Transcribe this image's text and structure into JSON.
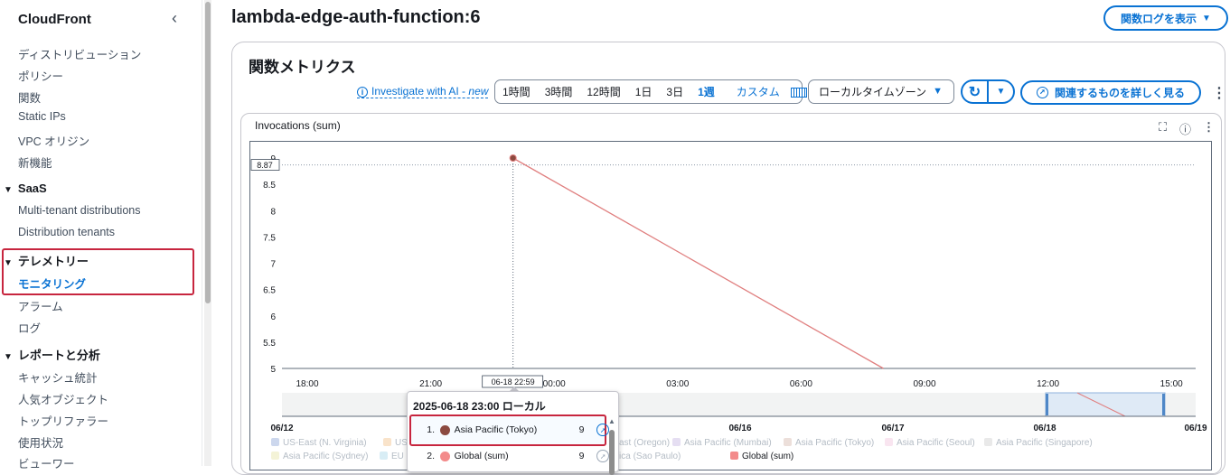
{
  "sidebar": {
    "title": "CloudFront",
    "items_top": [
      "ディストリビューション",
      "ポリシー",
      "関数",
      "Static IPs",
      "VPC オリジン",
      "新機能"
    ],
    "saas": {
      "label": "SaaS",
      "items": [
        "Multi-tenant distributions",
        "Distribution tenants"
      ]
    },
    "telemetry": {
      "label": "テレメトリー",
      "items": [
        "モニタリング",
        "アラーム",
        "ログ"
      ]
    },
    "reports": {
      "label": "レポートと分析",
      "items": [
        "キャッシュ統計",
        "人気オブジェクト",
        "トップリファラー",
        "使用状況",
        "ビューワー"
      ]
    }
  },
  "header": {
    "title": "lambda-edge-auth-function:6",
    "logs_button": "関数ログを表示"
  },
  "metrics": {
    "title": "関数メトリクス",
    "ai_link": "Investigate with AI - ",
    "ai_new": "new",
    "ranges": [
      "1時間",
      "3時間",
      "12時間",
      "1日",
      "3日",
      "1週"
    ],
    "selected_range": "1週",
    "custom": "カスタム",
    "timezone": "ローカルタイムゾーン",
    "explore_button": "関連するものを詳しく見る"
  },
  "widget": {
    "title": "Invocations (sum)"
  },
  "chart_data": {
    "type": "line",
    "title": "Invocations (sum)",
    "y_ticks": [
      "9",
      "8.5",
      "8",
      "7.5",
      "7",
      "6.5",
      "6",
      "5.5",
      "5"
    ],
    "ylim": [
      5,
      9
    ],
    "x_ticks": [
      "18:00",
      "21:00",
      "00:00",
      "03:00",
      "06:00",
      "09:00",
      "12:00",
      "15:00"
    ],
    "minimap_ticks": [
      "06/12",
      "06/16",
      "06/17",
      "06/18",
      "06/19"
    ],
    "hover_y_label": "8.87",
    "hover_x_label": "06-18 22:59",
    "series": [
      {
        "name": "Asia Pacific (Tokyo)",
        "color": "#e07f7f",
        "points": [
          {
            "x": "2025-06-18 23:00",
            "y": 9
          },
          {
            "x": "2025-06-19 08:00",
            "y": 5
          }
        ]
      }
    ],
    "legend": [
      {
        "name": "US-East (N. Virginia)",
        "color": "#8fa7d8",
        "faded": true
      },
      {
        "name": "US-",
        "color": "#f2c18a",
        "faded": true
      },
      {
        "name": "ast (Oregon)",
        "color": "#9ed39e",
        "faded": true
      },
      {
        "name": "Asia Pacific (Mumbai)",
        "color": "#c5b6e3",
        "faded": true
      },
      {
        "name": "Asia Pacific (Tokyo)",
        "color": "#d4b7ad",
        "faded": true
      },
      {
        "name": "Asia Pacific (Seoul)",
        "color": "#f2c6de",
        "faded": true
      },
      {
        "name": "Asia Pacific (Singapore)",
        "color": "#cfcfcf",
        "faded": true
      },
      {
        "name": "Asia Pacific (Sydney)",
        "color": "#e7e5a6",
        "faded": true
      },
      {
        "name": "EU",
        "color": "#a8d8e8",
        "faded": true
      },
      {
        "name": "uth America (Sao Paulo)",
        "color": "#aacbe6",
        "faded": true
      },
      {
        "name": "Global (sum)",
        "color": "#f38b8b",
        "faded": false
      }
    ]
  },
  "tooltip": {
    "header": "2025-06-18 23:00 ローカル",
    "rows": [
      {
        "index": "1.",
        "name": "Asia Pacific (Tokyo)",
        "value": "9",
        "color": "#8c4a40"
      },
      {
        "index": "2.",
        "name": "Global (sum)",
        "value": "9",
        "color": "#f38b8b"
      }
    ]
  }
}
